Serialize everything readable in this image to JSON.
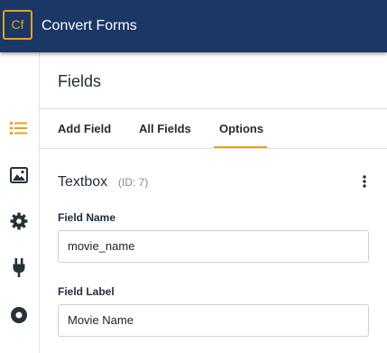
{
  "header": {
    "logo_text": "Cf",
    "app_name": "Convert Forms",
    "bg_color": "#1b3766",
    "accent_color": "#e3a21a"
  },
  "sidebar": {
    "items": [
      {
        "icon": "list-icon",
        "active": true
      },
      {
        "icon": "image-icon",
        "active": false
      },
      {
        "icon": "gear-icon",
        "active": false
      },
      {
        "icon": "plug-icon",
        "active": false
      },
      {
        "icon": "circle-icon",
        "active": false
      }
    ]
  },
  "panel": {
    "title": "Fields",
    "tabs": [
      {
        "label": "Add Field",
        "active": false
      },
      {
        "label": "All Fields",
        "active": false
      },
      {
        "label": "Options",
        "active": true
      }
    ]
  },
  "field": {
    "type": "Textbox",
    "id_text": "(ID: 7)",
    "name_label": "Field Name",
    "name_value": "movie_name",
    "label_label": "Field Label",
    "label_value": "Movie Name"
  }
}
